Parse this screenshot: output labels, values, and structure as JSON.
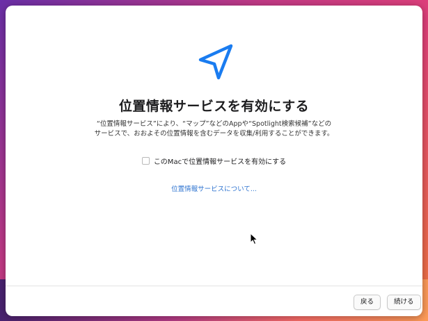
{
  "window": {
    "title": "位置情報サービスを有効にする",
    "description_line1": "“位置情報サービス”により、“マップ”などのAppや“Spotlight検索候補”などの",
    "description_line2": "サービスで、おおよその位置情報を含むデータを収集/利用することができます。",
    "checkbox_label": "このMacで位置情報サービスを有効にする",
    "checkbox_checked": false,
    "link_label": "位置情報サービスについて..."
  },
  "footer": {
    "back_label": "戻る",
    "continue_label": "続ける"
  },
  "icons": {
    "hero": "location-arrow-icon",
    "cursor": "mouse-pointer"
  },
  "colors": {
    "accent": "#1a7cf0",
    "link": "#2f74d0"
  }
}
